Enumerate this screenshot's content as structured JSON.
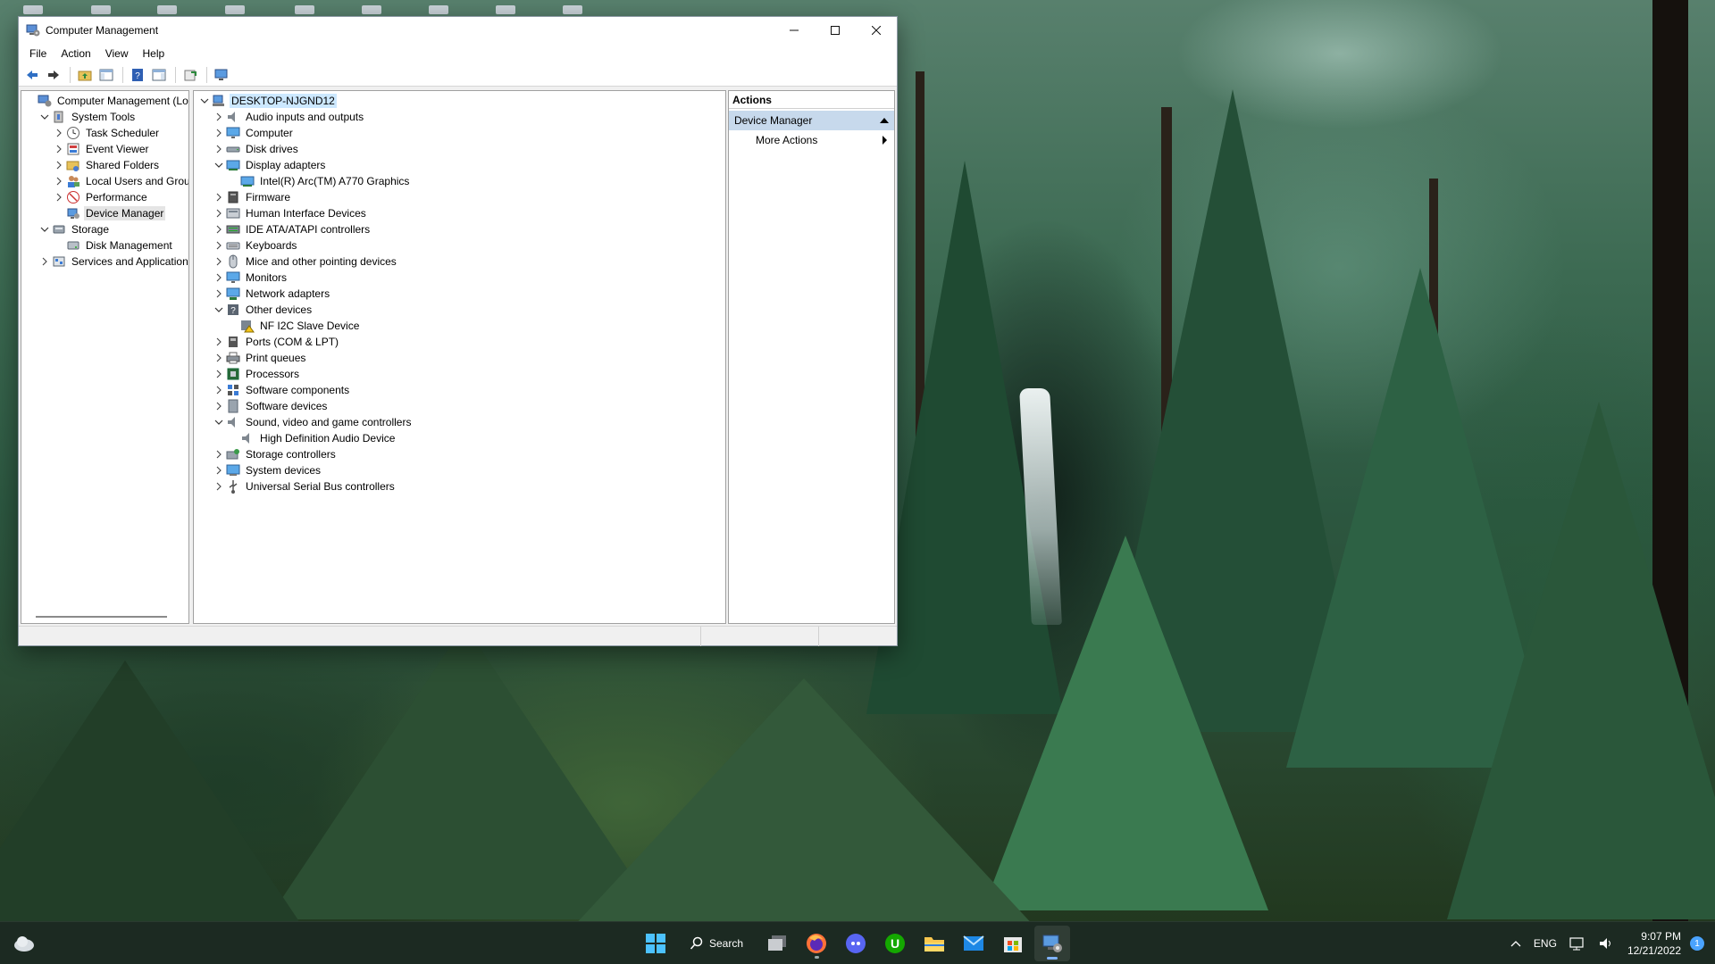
{
  "window": {
    "title": "Computer Management",
    "menu": [
      "File",
      "Action",
      "View",
      "Help"
    ]
  },
  "left_tree": [
    {
      "label": "Computer Management (Local",
      "level": 0,
      "chev": "",
      "icon": "computer-management-icon"
    },
    {
      "label": "System Tools",
      "level": 1,
      "chev": "down",
      "icon": "system-tools-icon"
    },
    {
      "label": "Task Scheduler",
      "level": 2,
      "chev": "right",
      "icon": "clock-icon"
    },
    {
      "label": "Event Viewer",
      "level": 2,
      "chev": "right",
      "icon": "event-viewer-icon"
    },
    {
      "label": "Shared Folders",
      "level": 2,
      "chev": "right",
      "icon": "shared-folder-icon"
    },
    {
      "label": "Local Users and Groups",
      "level": 2,
      "chev": "right",
      "icon": "users-icon"
    },
    {
      "label": "Performance",
      "level": 2,
      "chev": "right",
      "icon": "performance-icon"
    },
    {
      "label": "Device Manager",
      "level": 2,
      "chev": "",
      "icon": "device-manager-icon",
      "selected": true
    },
    {
      "label": "Storage",
      "level": 1,
      "chev": "down",
      "icon": "storage-icon"
    },
    {
      "label": "Disk Management",
      "level": 2,
      "chev": "",
      "icon": "disk-icon"
    },
    {
      "label": "Services and Applications",
      "level": 1,
      "chev": "right",
      "icon": "services-icon"
    }
  ],
  "device_tree": [
    {
      "label": "DESKTOP-NJGND12",
      "level": 0,
      "chev": "down",
      "icon": "computer-icon",
      "selected": true
    },
    {
      "label": "Audio inputs and outputs",
      "level": 1,
      "chev": "right",
      "icon": "speaker-icon"
    },
    {
      "label": "Computer",
      "level": 1,
      "chev": "right",
      "icon": "monitor-icon"
    },
    {
      "label": "Disk drives",
      "level": 1,
      "chev": "right",
      "icon": "disk-drive-icon"
    },
    {
      "label": "Display adapters",
      "level": 1,
      "chev": "down",
      "icon": "display-adapter-icon"
    },
    {
      "label": "Intel(R) Arc(TM) A770 Graphics",
      "level": 2,
      "chev": "",
      "icon": "display-adapter-icon"
    },
    {
      "label": "Firmware",
      "level": 1,
      "chev": "right",
      "icon": "firmware-icon"
    },
    {
      "label": "Human Interface Devices",
      "level": 1,
      "chev": "right",
      "icon": "hid-icon"
    },
    {
      "label": "IDE ATA/ATAPI controllers",
      "level": 1,
      "chev": "right",
      "icon": "ide-icon"
    },
    {
      "label": "Keyboards",
      "level": 1,
      "chev": "right",
      "icon": "keyboard-icon"
    },
    {
      "label": "Mice and other pointing devices",
      "level": 1,
      "chev": "right",
      "icon": "mouse-icon"
    },
    {
      "label": "Monitors",
      "level": 1,
      "chev": "right",
      "icon": "monitor-icon"
    },
    {
      "label": "Network adapters",
      "level": 1,
      "chev": "right",
      "icon": "network-icon"
    },
    {
      "label": "Other devices",
      "level": 1,
      "chev": "down",
      "icon": "other-devices-icon"
    },
    {
      "label": "NF I2C Slave Device",
      "level": 2,
      "chev": "",
      "icon": "warning-device-icon"
    },
    {
      "label": "Ports (COM & LPT)",
      "level": 1,
      "chev": "right",
      "icon": "port-icon"
    },
    {
      "label": "Print queues",
      "level": 1,
      "chev": "right",
      "icon": "printer-icon"
    },
    {
      "label": "Processors",
      "level": 1,
      "chev": "right",
      "icon": "processor-icon"
    },
    {
      "label": "Software components",
      "level": 1,
      "chev": "right",
      "icon": "software-components-icon"
    },
    {
      "label": "Software devices",
      "level": 1,
      "chev": "right",
      "icon": "software-device-icon"
    },
    {
      "label": "Sound, video and game controllers",
      "level": 1,
      "chev": "down",
      "icon": "speaker-icon"
    },
    {
      "label": "High Definition Audio Device",
      "level": 2,
      "chev": "",
      "icon": "speaker-icon"
    },
    {
      "label": "Storage controllers",
      "level": 1,
      "chev": "right",
      "icon": "storage-controller-icon"
    },
    {
      "label": "System devices",
      "level": 1,
      "chev": "right",
      "icon": "system-devices-icon"
    },
    {
      "label": "Universal Serial Bus controllers",
      "level": 1,
      "chev": "right",
      "icon": "usb-icon"
    }
  ],
  "actions": {
    "header": "Actions",
    "section": "Device Manager",
    "items": [
      "More Actions"
    ]
  },
  "taskbar": {
    "search_label": "Search",
    "apps": [
      "start-icon",
      "search",
      "task-view-icon",
      "firefox-icon",
      "discord-icon",
      "upwork-icon",
      "file-explorer-icon",
      "mail-icon",
      "store-icon",
      "computer-management-icon"
    ],
    "language": "ENG",
    "time": "9:07 PM",
    "date": "12/21/2022",
    "notification_count": "1"
  },
  "colors": {
    "accent": "#0078d4",
    "selection_blue": "#cce8ff",
    "actions_section_bg": "#c7d9ec",
    "taskbar_bg": "#1c2a22"
  }
}
